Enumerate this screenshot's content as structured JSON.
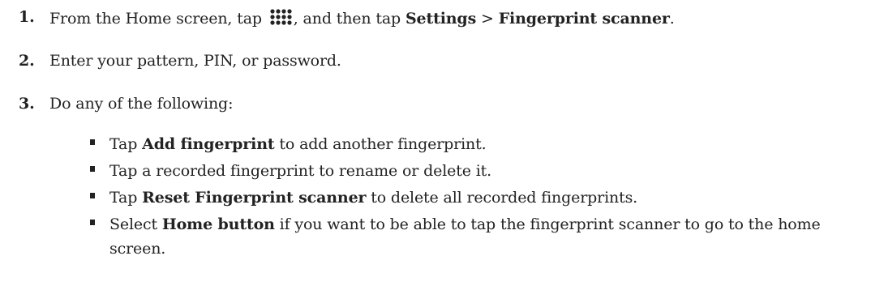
{
  "steps": [
    {
      "number": "1.",
      "before_icon": "From the Home screen, tap ",
      "icon": "apps-grid-icon",
      "after_icon": ", and then tap ",
      "settings": "Settings",
      "separator": " > ",
      "fingerprint_scanner": "Fingerprint scanner",
      "end": "."
    },
    {
      "number": "2.",
      "text": "Enter your pattern, PIN, or password."
    },
    {
      "number": "3.",
      "text": "Do any of the following:"
    }
  ],
  "bullets": [
    {
      "pre": "Tap ",
      "bold": "Add fingerprint",
      "post": " to add another fingerprint."
    },
    {
      "text": "Tap a recorded fingerprint to rename or delete it."
    },
    {
      "pre": "Tap ",
      "bold": "Reset Fingerprint scanner",
      "post": " to delete all recorded fingerprints."
    },
    {
      "pre": "Select ",
      "bold": "Home button",
      "post": " if you want to be able to tap the fingerprint scanner to go to the home screen."
    }
  ]
}
